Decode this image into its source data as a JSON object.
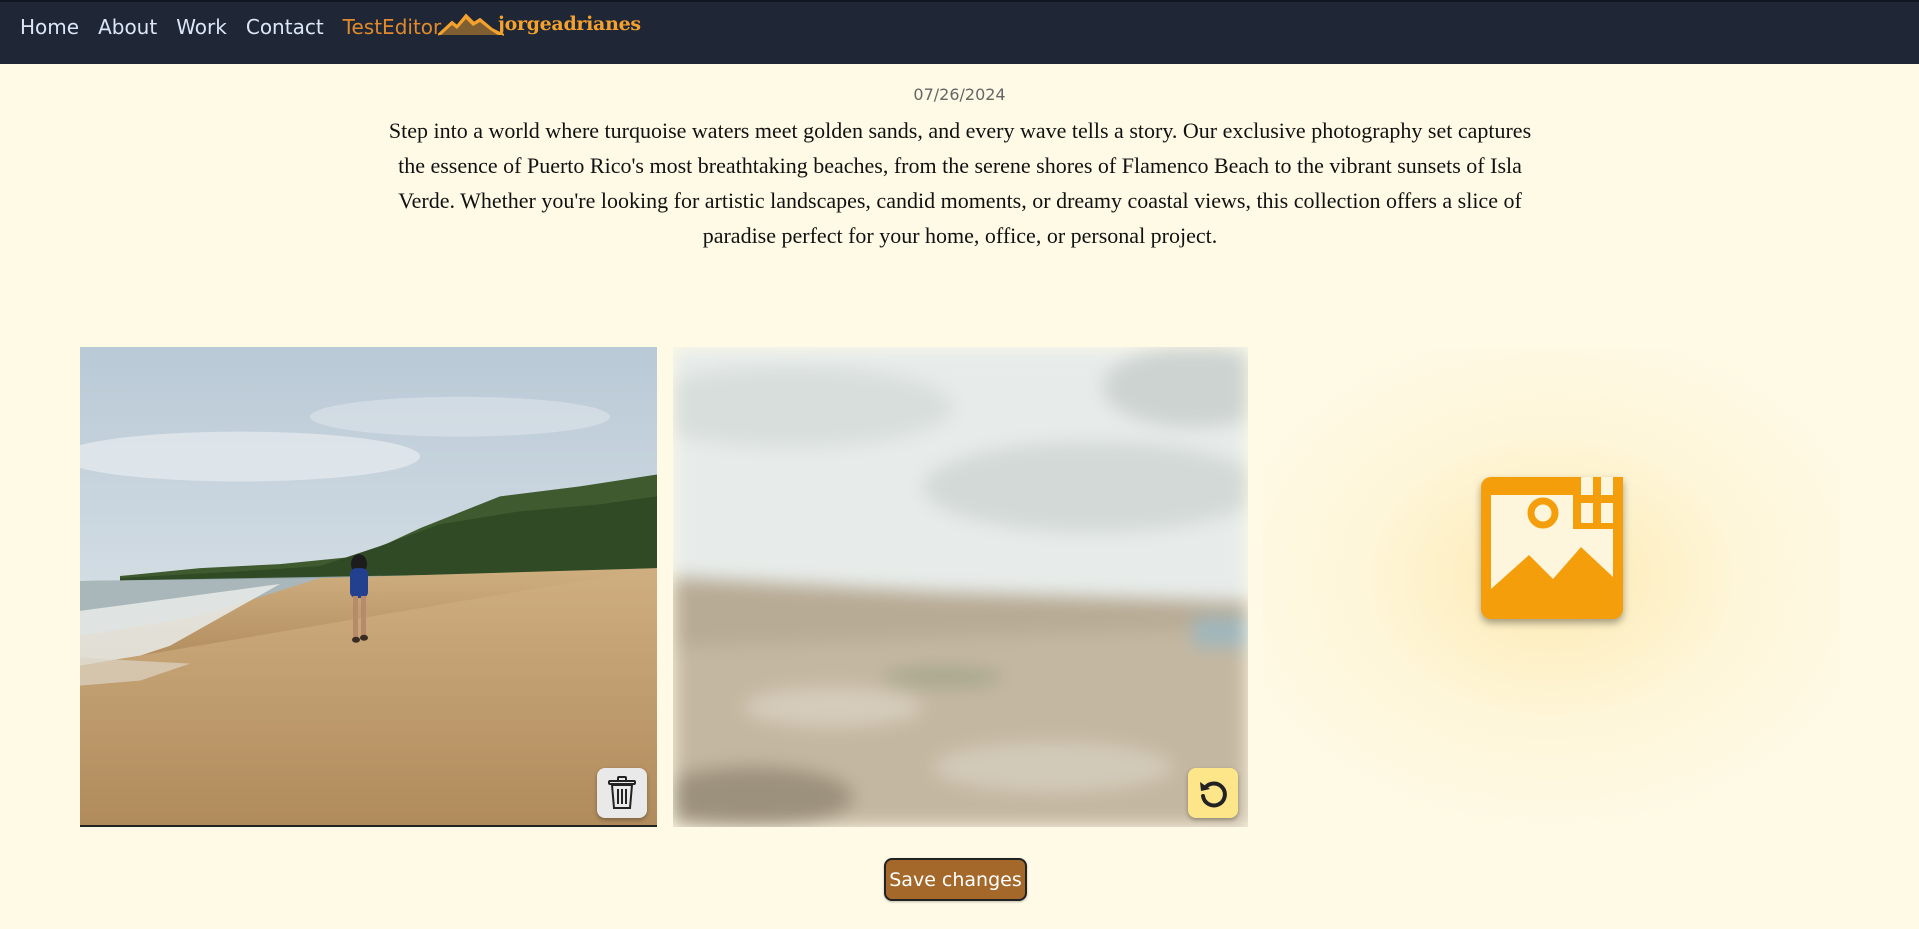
{
  "nav": {
    "items": [
      {
        "label": "Home"
      },
      {
        "label": "About"
      },
      {
        "label": "Work"
      },
      {
        "label": "Contact"
      },
      {
        "label": "TestEditor",
        "active": true
      }
    ],
    "logo_text": "jorgeadrianes",
    "background": "#1f2737",
    "link_color": "#dbe7f7",
    "active_color": "#e08a2c",
    "logo_color": "#f4a22d"
  },
  "post": {
    "date": "07/26/2024",
    "description": "Step into a world where turquoise waters meet golden sands, and every wave tells a story. Our exclusive photography set captures the essence of Puerto Rico's most breathtaking beaches, from the serene shores of Flamenco Beach to the vibrant sunsets of Isla Verde. Whether you're looking for artistic landscapes, candid moments, or dreamy coastal views, this collection offers a slice of paradise perfect for your home, office, or personal project."
  },
  "gallery": {
    "images": [
      {
        "content": "woman walking on a sandy beach beside the ocean and palm-covered hills",
        "action_icon": "trash-icon",
        "state": "normal"
      },
      {
        "content": "rocky coastal cliff under a cloudy sky",
        "action_icon": "restore-icon",
        "state": "marked-for-deletion"
      }
    ],
    "add_icon": "add-image-icon"
  },
  "actions": {
    "save_label": "Save changes"
  },
  "colors": {
    "page_background": "#fefae6",
    "save_button": "#a4692a",
    "add_icon": "#f59e0b",
    "restore_button": "#fde68a",
    "delete_button": "#e9e9ea"
  }
}
